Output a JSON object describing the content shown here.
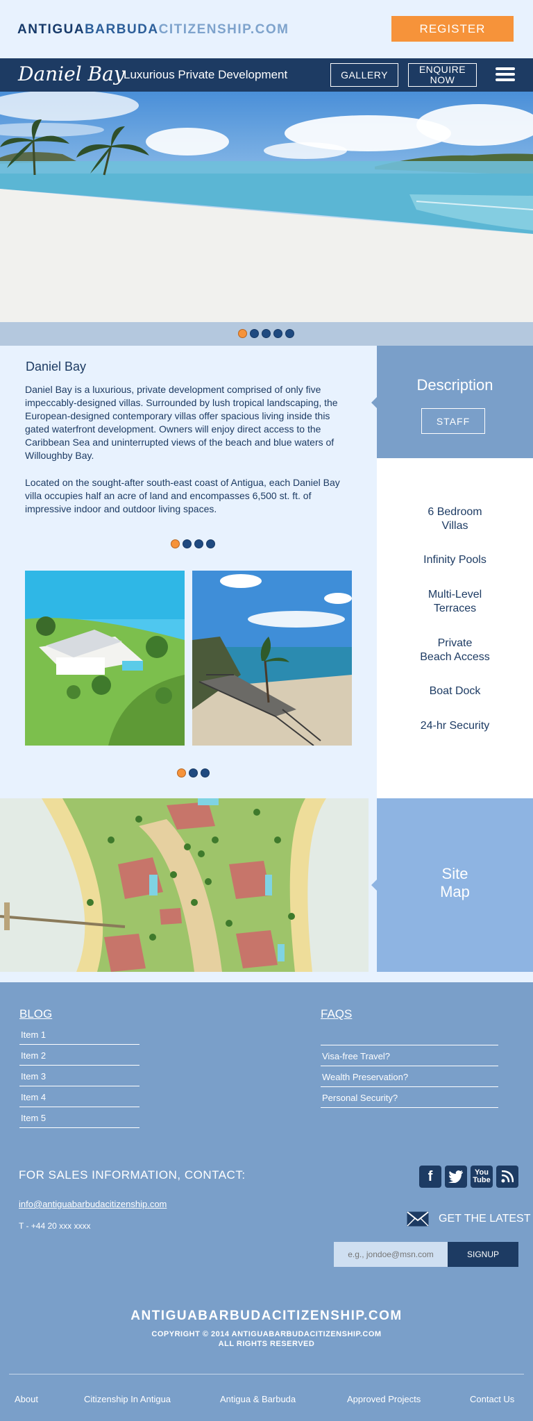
{
  "header": {
    "brand_part1": "ANTIGUA",
    "brand_part2": "BARBUDA",
    "brand_part3": "CITIZENSHIP.COM",
    "register_label": "REGISTER"
  },
  "navbar": {
    "logo": "Daniel Bay",
    "tagline": "Luxurious Private Development",
    "gallery_label": "GALLERY",
    "enquire_line1": "ENQUIRE",
    "enquire_line2": "NOW",
    "menu_icon": "hamburger-icon"
  },
  "hero": {
    "slide_count": 5,
    "active_slide": 1
  },
  "content": {
    "title": "Daniel Bay",
    "paragraph1": "Daniel Bay is a luxurious, private development comprised of only five impeccably-designed villas. Surrounded by lush tropical landscaping, the European-designed contemporary villas offer spacious living inside this gated waterfront development. Owners will enjoy direct access to the Caribbean Sea and uninterrupted views of the beach and blue waters of Willoughby Bay.",
    "paragraph2": "Located on the sought-after south-east coast of Antigua, each Daniel Bay villa occupies half an acre of land and encompasses 6,500 st. ft. of impressive indoor and outdoor living spaces.",
    "text_carousel": {
      "count": 4,
      "active": 1
    },
    "photo_carousel": {
      "count": 3,
      "active": 1
    }
  },
  "description_panel": {
    "title": "Description",
    "staff_label": "STAFF"
  },
  "features": [
    {
      "line1": "6 Bedroom",
      "line2": "Villas"
    },
    {
      "line1": "Infinity Pools",
      "line2": ""
    },
    {
      "line1": "Multi-Level",
      "line2": "Terraces"
    },
    {
      "line1": "Private",
      "line2": "Beach Access"
    },
    {
      "line1": "Boat Dock",
      "line2": ""
    },
    {
      "line1": "24-hr Security",
      "line2": ""
    }
  ],
  "sitemap": {
    "line1": "Site",
    "line2": "Map"
  },
  "footer": {
    "blog_title": "BLOG",
    "blog_items": [
      "Item 1",
      "Item 2",
      "Item 3",
      "Item 4",
      "Item 5"
    ],
    "faq_title": "FAQS",
    "faq_items": [
      "Visa-free Travel?",
      "Wealth Preservation?",
      "Personal Security?"
    ],
    "sales_heading": "FOR SALES INFORMATION, CONTACT:",
    "email": "info@antiguabarbudacitizenship.com",
    "phone": "T - +44 20 xxx xxxx",
    "social": {
      "facebook": "f",
      "twitter": "t",
      "youtube_line1": "You",
      "youtube_line2": "Tube",
      "rss": "rss"
    },
    "get_latest": "GET THE LATEST",
    "signup_placeholder": "e.g., jondoe@msn.com",
    "signup_label": "SIGNUP",
    "brand": "ANTIGUABARBUDACITIZENSHIP.COM",
    "copyright_line1": "COPYRIGHT © 2014 ANTIGUABARBUDACITIZENSHIP.COM",
    "copyright_line2": "ALL RIGHTS RESERVED",
    "bottom_nav": [
      "About",
      "Citizenship In Antigua",
      "Antigua & Barbuda",
      "Approved Projects",
      "Contact Us"
    ]
  },
  "colors": {
    "navy": "#1d3b63",
    "orange": "#f6933a",
    "light_bg": "#e8f2fe",
    "panel_blue": "#7a9fc9",
    "sitemap_blue": "#8eb4e2"
  }
}
